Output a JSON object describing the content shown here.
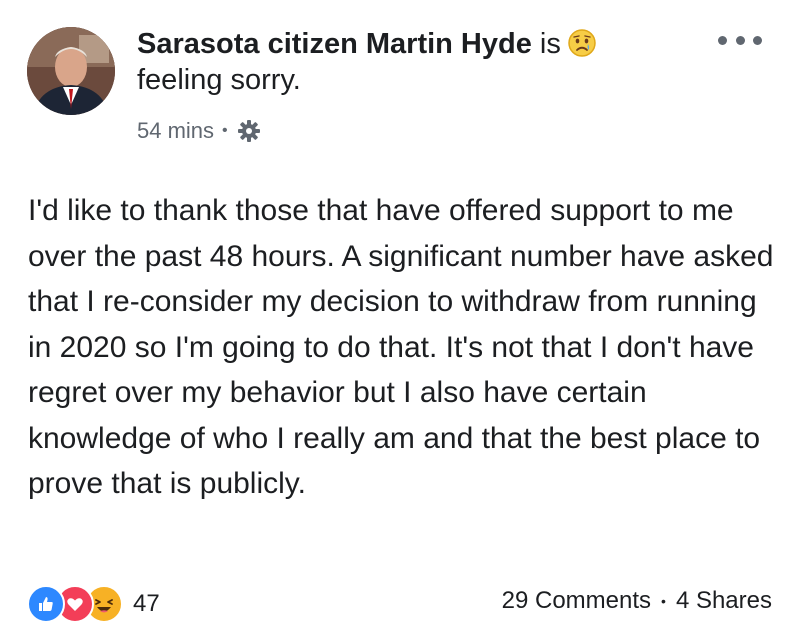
{
  "post": {
    "author": "Sarasota citizen Martin Hyde",
    "verb": "is",
    "feeling": "feeling sorry.",
    "timestamp": "54 mins",
    "meta_separator": "•",
    "body": "I'd like to thank those that have offered support to me over the past 48 hours. A significant number have asked that I re-consider my decision to withdraw from running in 2020 so I'm going to do that. It's not that I don't have regret over my behavior but I also have certain knowledge of who I really am and that the best place to prove that is publicly."
  },
  "reactions": {
    "types": [
      "like",
      "love",
      "haha"
    ],
    "count": "47"
  },
  "stats": {
    "comments": "29 Comments",
    "separator": "•",
    "shares": "4 Shares"
  },
  "icons": {
    "more": "more-options-icon",
    "audience": "gear-icon",
    "feeling": "sad-face-icon"
  },
  "colors": {
    "like": "#2d88ff",
    "love": "#f33e58",
    "haha": "#f7b125",
    "secondary_text": "#606770"
  }
}
